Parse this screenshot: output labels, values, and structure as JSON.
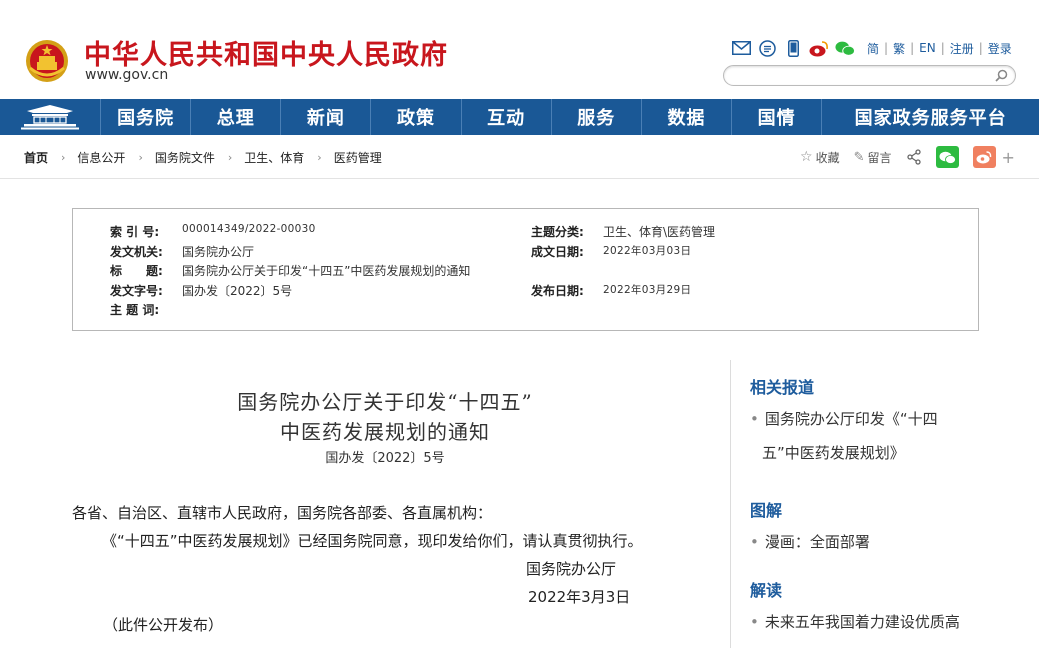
{
  "header": {
    "site_title": "中华人民共和国中央人民政府",
    "site_url": "www.gov.cn",
    "icons": [
      "mail-icon",
      "message-icon",
      "mobile-icon",
      "weibo-icon",
      "wechat-icon"
    ],
    "lang_links": [
      "简",
      "繁",
      "EN",
      "注册",
      "登录"
    ],
    "search_placeholder": ""
  },
  "nav": {
    "items": [
      "国务院",
      "总理",
      "新闻",
      "政策",
      "互动",
      "服务",
      "数据",
      "国情",
      "国家政务服务平台"
    ]
  },
  "breadcrumb": [
    "首页",
    "信息公开",
    "国务院文件",
    "卫生、体育",
    "医药管理"
  ],
  "tools": {
    "favorite": "收藏",
    "comment": "留言"
  },
  "info": {
    "index_label": "索 引 号:",
    "index_value": "000014349/2022-00030",
    "issuer_label": "发文机关:",
    "issuer_value": "国务院办公厅",
    "title_label": "标　　题:",
    "title_value": "国务院办公厅关于印发“十四五”中医药发展规划的通知",
    "docno_label": "发文字号:",
    "docno_value": "国办发〔2022〕5号",
    "keywords_label": "主 题 词:",
    "keywords_value": "",
    "category_label": "主题分类:",
    "category_value": "卫生、体育\\医药管理",
    "created_label": "成文日期:",
    "created_value": "2022年03月03日",
    "published_label": "发布日期:",
    "published_value": "2022年03月29日"
  },
  "article": {
    "title_line1": "国务院办公厅关于印发“十四五”",
    "title_line2": "中医药发展规划的通知",
    "doc_number": "国办发〔2022〕5号",
    "salutation": "各省、自治区、直辖市人民政府，国务院各部委、各直属机构：",
    "para1": "《“十四五”中医药发展规划》已经国务院同意，现印发给你们，请认真贯彻执行。",
    "signature": "国务院办公厅",
    "date": "2022年3月3日",
    "note": "（此件公开发布）"
  },
  "sidebar": {
    "related_title": "相关报道",
    "related_item_line1": "国务院办公厅印发《“十四",
    "related_item_line2": "五”中医药发展规划》",
    "graphic_title": "图解",
    "graphic_item": "漫画：全面部署",
    "interpret_title": "解读",
    "interpret_item": "未来五年我国着力建设优质高"
  },
  "colors": {
    "brand_red": "#c8161d",
    "nav_blue": "#1a5896",
    "link_blue": "#1e5c9d",
    "wechat_green": "#2dbb40",
    "weibo_orange": "#f08060"
  }
}
